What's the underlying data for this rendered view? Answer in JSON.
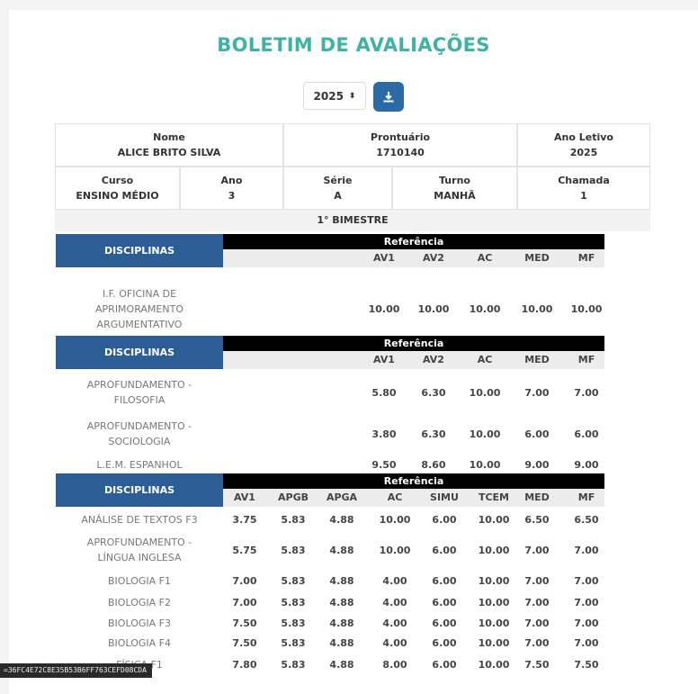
{
  "title": "BOLETIM DE AVALIAÇÕES",
  "year_select": {
    "value": "2025",
    "arrows": "⬍"
  },
  "download_icon": "download-icon",
  "info": {
    "nome": {
      "label": "Nome",
      "value": "ALICE BRITO SILVA"
    },
    "prontuario": {
      "label": "Prontuário",
      "value": "1710140"
    },
    "ano_letivo": {
      "label": "Ano Letivo",
      "value": "2025"
    },
    "curso": {
      "label": "Curso",
      "value": "ENSINO MÉDIO"
    },
    "ano": {
      "label": "Ano",
      "value": "3"
    },
    "serie": {
      "label": "Série",
      "value": "A"
    },
    "turno": {
      "label": "Turno",
      "value": "MANHÃ"
    },
    "chamada": {
      "label": "Chamada",
      "value": "1"
    }
  },
  "bimestre": "1° BIMESTRE",
  "sections": [
    {
      "disc_label": "DISCIPLINAS",
      "ref_label": "Referência",
      "columns": [
        "AV1",
        "AV2",
        "AC",
        "MED",
        "MF"
      ],
      "rows": [
        {
          "name": "I.F. OFICINA DE APRIMORAMENTO ARGUMENTATIVO",
          "name_lines": [
            "I.F. OFICINA DE",
            "APRIMORAMENTO",
            "ARGUMENTATIVO"
          ],
          "values": [
            "10.00",
            "10.00",
            "10.00",
            "10.00",
            "10.00"
          ]
        }
      ]
    },
    {
      "disc_label": "DISCIPLINAS",
      "ref_label": "Referência",
      "columns": [
        "AV1",
        "AV2",
        "AC",
        "MED",
        "MF"
      ],
      "rows": [
        {
          "name_lines": [
            "APROFUNDAMENTO -",
            "FILOSOFIA"
          ],
          "values": [
            "5.80",
            "6.30",
            "10.00",
            "7.00",
            "7.00"
          ]
        },
        {
          "name_lines": [
            "APROFUNDAMENTO -",
            "SOCIOLOGIA"
          ],
          "values": [
            "3.80",
            "6.30",
            "10.00",
            "6.00",
            "6.00"
          ]
        },
        {
          "name_lines": [
            "L.E.M. ESPANHOL"
          ],
          "values": [
            "9.50",
            "8.60",
            "10.00",
            "9.00",
            "9.00"
          ]
        }
      ]
    },
    {
      "disc_label": "DISCIPLINAS",
      "ref_label": "Referência",
      "columns": [
        "AV1",
        "APGB",
        "APGA",
        "AC",
        "SIMU",
        "TCEM",
        "MED",
        "MF"
      ],
      "rows": [
        {
          "name_lines": [
            "ANÁLISE DE TEXTOS F3"
          ],
          "values": [
            "3.75",
            "5.83",
            "4.88",
            "10.00",
            "6.00",
            "10.00",
            "6.50",
            "6.50"
          ]
        },
        {
          "name_lines": [
            "APROFUNDAMENTO -",
            "LÍNGUA INGLESA"
          ],
          "values": [
            "5.75",
            "5.83",
            "4.88",
            "10.00",
            "6.00",
            "10.00",
            "7.00",
            "7.00"
          ]
        },
        {
          "name_lines": [
            "BIOLOGIA F1"
          ],
          "values": [
            "7.00",
            "5.83",
            "4.88",
            "4.00",
            "6.00",
            "10.00",
            "7.00",
            "7.00"
          ]
        },
        {
          "name_lines": [
            "BIOLOGIA F2"
          ],
          "values": [
            "7.00",
            "5.83",
            "4.88",
            "4.00",
            "6.00",
            "10.00",
            "7.00",
            "7.00"
          ]
        },
        {
          "name_lines": [
            "BIOLOGIA F3"
          ],
          "values": [
            "7.50",
            "5.83",
            "4.88",
            "4.00",
            "6.00",
            "10.00",
            "7.00",
            "7.00"
          ]
        },
        {
          "name_lines": [
            "BIOLOGIA F4"
          ],
          "values": [
            "7.50",
            "5.83",
            "4.88",
            "4.00",
            "6.00",
            "10.00",
            "7.00",
            "7.00"
          ]
        },
        {
          "name_lines": [
            "FÍSICA F1"
          ],
          "values": [
            "7.80",
            "5.83",
            "4.88",
            "8.00",
            "6.00",
            "10.00",
            "7.50",
            "7.50"
          ]
        }
      ]
    }
  ],
  "status_tooltip": "=36FC4E72C8E35B53B6FF763CEFD08CDA",
  "colors": {
    "accent": "#3fb3a3",
    "disc_header": "#2c5e95",
    "button": "#2c6aa6"
  }
}
